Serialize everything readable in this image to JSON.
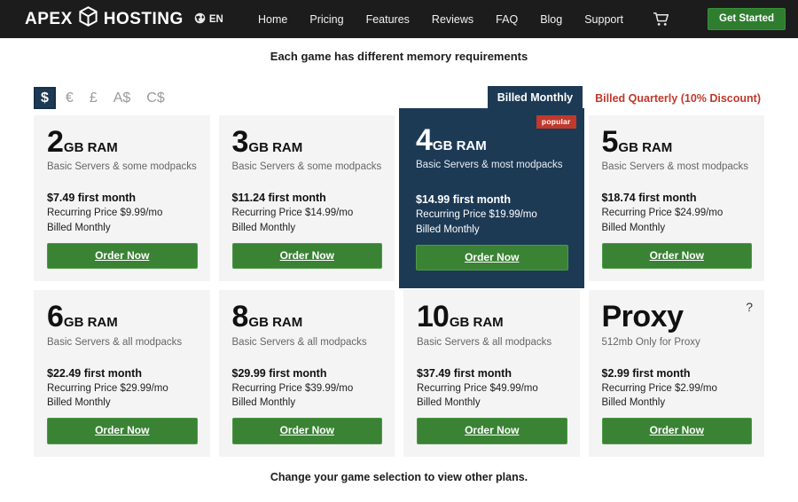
{
  "navbar": {
    "brand_left": "APEX",
    "brand_right": "HOSTING",
    "brand_icon": "cube-icon",
    "globe_icon": "globe-icon",
    "language": "EN",
    "links": [
      {
        "label": "Home"
      },
      {
        "label": "Pricing"
      },
      {
        "label": "Features"
      },
      {
        "label": "Reviews"
      },
      {
        "label": "FAQ"
      },
      {
        "label": "Blog"
      },
      {
        "label": "Support"
      }
    ],
    "cart_icon": "shopping-cart-icon",
    "cta_label": "Get Started",
    "background_color": "#1c1c1c",
    "cta_color": "#2f7d2f"
  },
  "headings": {
    "subhead": "Each game has different memory requirements",
    "footnote": "Change your game selection to view other plans."
  },
  "controls": {
    "currencies": [
      {
        "symbol": "$",
        "selected": true
      },
      {
        "symbol": "€",
        "selected": false
      },
      {
        "symbol": "£",
        "selected": false
      },
      {
        "symbol": "A$",
        "selected": false
      },
      {
        "symbol": "C$",
        "selected": false
      }
    ],
    "billing_monthly_label": "Billed Monthly",
    "billing_quarterly_label": "Billed Quarterly (10% Discount)",
    "accent_navy": "#1d3A55",
    "accent_red": "#c0392b"
  },
  "plans": [
    {
      "ram_number": "2",
      "ram_unit": "GB RAM",
      "description": "Basic Servers & some modpacks",
      "first_month": "$7.49 first month",
      "recurring": "Recurring Price $9.99/mo",
      "billed": "Billed Monthly",
      "order_label": "Order Now",
      "featured": false,
      "badge": null,
      "help": false
    },
    {
      "ram_number": "3",
      "ram_unit": "GB RAM",
      "description": "Basic Servers & some modpacks",
      "first_month": "$11.24 first month",
      "recurring": "Recurring Price $14.99/mo",
      "billed": "Billed Monthly",
      "order_label": "Order Now",
      "featured": false,
      "badge": null,
      "help": false
    },
    {
      "ram_number": "4",
      "ram_unit": "GB RAM",
      "description": "Basic Servers & most modpacks",
      "first_month": "$14.99 first month",
      "recurring": "Recurring Price $19.99/mo",
      "billed": "Billed Monthly",
      "order_label": "Order Now",
      "featured": true,
      "badge": "popular",
      "help": false
    },
    {
      "ram_number": "5",
      "ram_unit": "GB RAM",
      "description": "Basic Servers & most modpacks",
      "first_month": "$18.74 first month",
      "recurring": "Recurring Price $24.99/mo",
      "billed": "Billed Monthly",
      "order_label": "Order Now",
      "featured": false,
      "badge": null,
      "help": false
    },
    {
      "ram_number": "6",
      "ram_unit": "GB RAM",
      "description": "Basic Servers & all modpacks",
      "first_month": "$22.49 first month",
      "recurring": "Recurring Price $29.99/mo",
      "billed": "Billed Monthly",
      "order_label": "Order Now",
      "featured": false,
      "badge": null,
      "help": false
    },
    {
      "ram_number": "8",
      "ram_unit": "GB RAM",
      "description": "Basic Servers & all modpacks",
      "first_month": "$29.99 first month",
      "recurring": "Recurring Price $39.99/mo",
      "billed": "Billed Monthly",
      "order_label": "Order Now",
      "featured": false,
      "badge": null,
      "help": false
    },
    {
      "ram_number": "10",
      "ram_unit": "GB RAM",
      "description": "Basic Servers & all modpacks",
      "first_month": "$37.49 first month",
      "recurring": "Recurring Price $49.99/mo",
      "billed": "Billed Monthly",
      "order_label": "Order Now",
      "featured": false,
      "badge": null,
      "help": false
    },
    {
      "ram_number": "Proxy",
      "ram_unit": "",
      "description": "512mb Only for Proxy",
      "first_month": "$2.99 first month",
      "recurring": "Recurring Price $2.99/mo",
      "billed": "Billed Monthly",
      "order_label": "Order Now",
      "featured": false,
      "badge": null,
      "help": true,
      "help_glyph": "?"
    }
  ]
}
